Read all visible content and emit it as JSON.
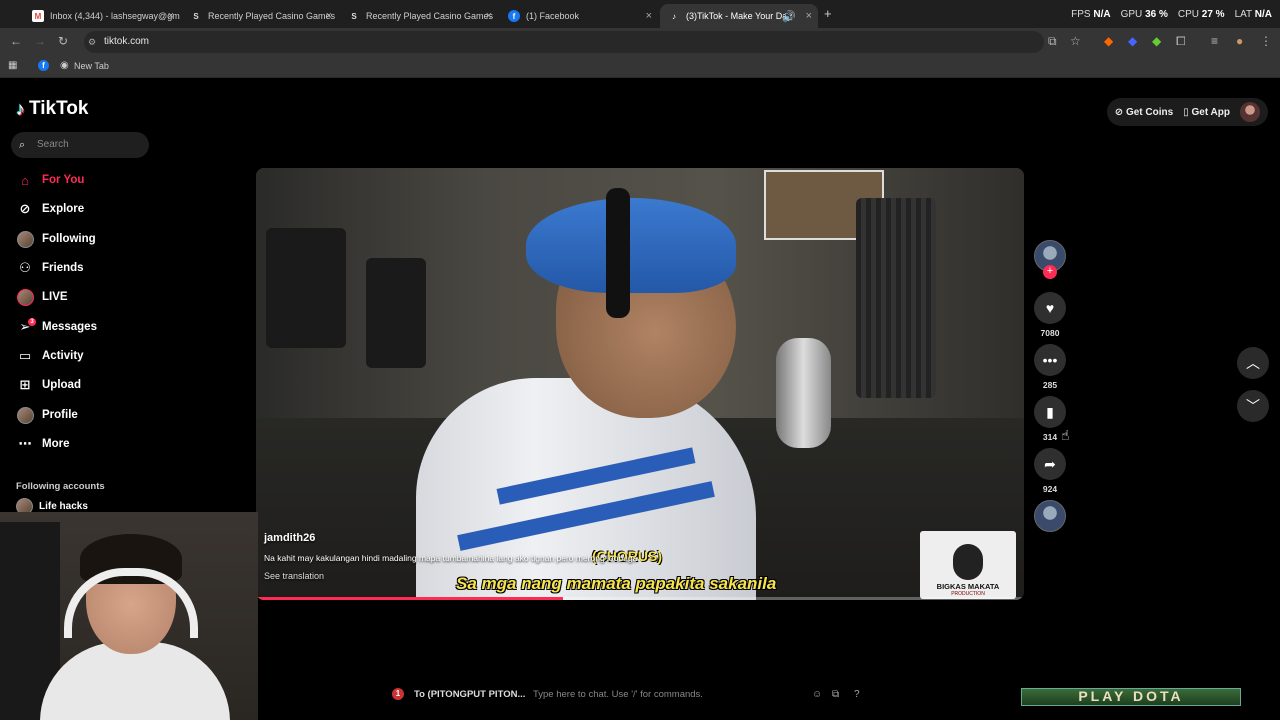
{
  "browser": {
    "tabs": [
      {
        "label": "Inbox (4,344) - lashsegway@gm",
        "fav": "M",
        "fav_color": "#ea4335"
      },
      {
        "label": "Recently Played Casino Games",
        "fav": "S",
        "fav_color": "#555555"
      },
      {
        "label": "Recently Played Casino Games",
        "fav": "S",
        "fav_color": "#555555"
      },
      {
        "label": "(1) Facebook",
        "fav": "f",
        "fav_color": "#1877f2"
      },
      {
        "label": "(3)TikTok - Make Your Day",
        "fav": "♪",
        "fav_color": "#000000"
      }
    ],
    "url": "tiktok.com",
    "bookmark": "New Tab",
    "stats": {
      "fps_label": "FPS",
      "fps": "N/A",
      "gpu_label": "GPU",
      "gpu": "36 %",
      "cpu_label": "CPU",
      "cpu": "27 %",
      "lat_label": "LAT",
      "lat": "N/A"
    }
  },
  "sidebar": {
    "logo": "TikTok",
    "search_placeholder": "Search",
    "items": [
      {
        "label": "For You",
        "icon": "home-icon"
      },
      {
        "label": "Explore",
        "icon": "compass-icon"
      },
      {
        "label": "Following",
        "icon": "following-avatar"
      },
      {
        "label": "Friends",
        "icon": "friends-icon"
      },
      {
        "label": "LIVE",
        "icon": "live-avatar"
      },
      {
        "label": "Messages",
        "icon": "messages-icon",
        "badge": "3"
      },
      {
        "label": "Activity",
        "icon": "activity-icon"
      },
      {
        "label": "Upload",
        "icon": "upload-icon"
      },
      {
        "label": "Profile",
        "icon": "profile-avatar"
      },
      {
        "label": "More",
        "icon": "more-icon"
      }
    ],
    "following_heading": "Following accounts",
    "following": [
      {
        "name": "Life hacks"
      }
    ]
  },
  "header": {
    "get_coins": "Get Coins",
    "get_app": "Get App"
  },
  "video": {
    "username": "jamdith26",
    "description": "Na kahit may kakulangan hindi madaling mapa tumbamahina lang ako tignan pero merong loobuga",
    "see_translation": "See translation",
    "chorus": "(CHORUS)",
    "subtitle": "Sa mga nang mamata papakita sakanila",
    "watermark_title": "BIGKAS MAKATA",
    "watermark_sub": "PRODUCTION",
    "progress": 0.4
  },
  "actions": {
    "likes": "7080",
    "comments": "285",
    "saves": "314",
    "shares": "924"
  },
  "chat": {
    "count": "1",
    "to": "To (PITONGPUT PITON...",
    "placeholder": "Type here to chat. Use '/' for commands."
  },
  "overlay": {
    "play_dota": "PLAY DOTA"
  },
  "colors": {
    "accent": "#fe2c55",
    "subtitle": "#f7e44d"
  }
}
